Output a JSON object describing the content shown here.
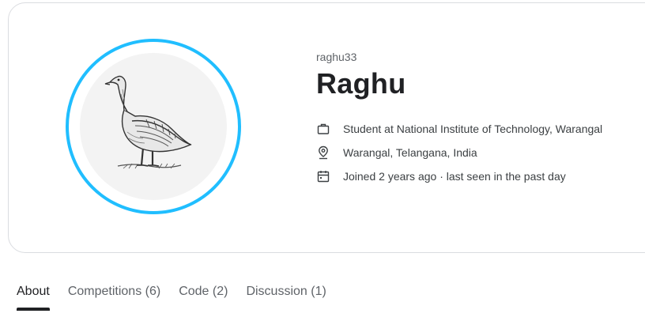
{
  "profile": {
    "username": "raghu33",
    "display_name": "Raghu",
    "occupation": "Student at National Institute of Technology, Warangal",
    "location": "Warangal, Telangana, India",
    "activity": "Joined 2 years ago · last seen in the past day"
  },
  "icons": {
    "occupation": "briefcase-icon",
    "location": "location-pin-icon",
    "activity": "calendar-icon"
  },
  "colors": {
    "avatar_ring": "#20beff",
    "avatar_bg": "#f3f3f3",
    "active_tab_indicator": "#202124"
  },
  "tabs": [
    {
      "label": "About",
      "active": true
    },
    {
      "label": "Competitions (6)",
      "active": false
    },
    {
      "label": "Code (2)",
      "active": false
    },
    {
      "label": "Discussion (1)",
      "active": false
    }
  ]
}
